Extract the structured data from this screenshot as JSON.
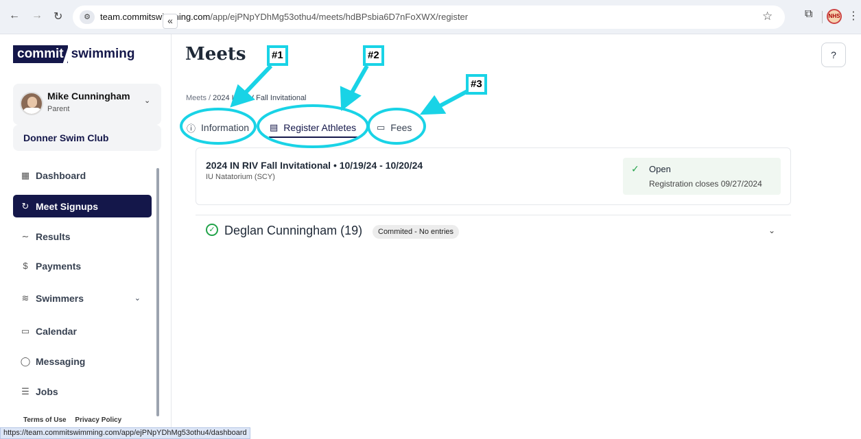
{
  "browser": {
    "url_domain": "team.commitswimming.com",
    "url_path": "/app/ejPNpYDhMg53othu4/meets/hdBPsbia6D7nFoXWX/register",
    "status_url": "https://team.commitswimming.com/app/ejPNpYDhMg53othu4/dashboard",
    "profile_text": "NHS"
  },
  "sidebar": {
    "logo_left": "commit",
    "logo_right": "swimming",
    "user_name": "Mike Cunningham",
    "user_role": "Parent",
    "club": "Donner Swim Club",
    "items": [
      {
        "label": "Dashboard",
        "icon": "grid-icon"
      },
      {
        "label": "Meet Signups",
        "icon": "swimmer-icon"
      },
      {
        "label": "Results",
        "icon": "chart-icon"
      },
      {
        "label": "Payments",
        "icon": "dollar-icon"
      },
      {
        "label": "Swimmers",
        "icon": "swim-icon"
      },
      {
        "label": "Calendar",
        "icon": "calendar-icon"
      },
      {
        "label": "Messaging",
        "icon": "chat-icon"
      },
      {
        "label": "Jobs",
        "icon": "list-icon"
      }
    ],
    "footer": {
      "terms": "Terms of Use",
      "privacy": "Privacy Policy"
    }
  },
  "main": {
    "title": "Meets",
    "breadcrumb": {
      "root": "Meets",
      "sep": "/",
      "current": "2024 IN RIV Fall Invitational"
    },
    "tabs": [
      {
        "label": "Information"
      },
      {
        "label": "Register Athletes"
      },
      {
        "label": "Fees"
      }
    ],
    "meet": {
      "title": "2024 IN RIV Fall Invitational • 10/19/24 - 10/20/24",
      "location": "IU Natatorium (SCY)",
      "status": "Open",
      "closes": "Registration closes 09/27/2024"
    },
    "athlete": {
      "name": "Deglan Cunningham (19)",
      "badge": "Commited - No entries"
    }
  },
  "annotations": [
    "#1",
    "#2",
    "#3"
  ],
  "colors": {
    "brand": "#14174a",
    "accent": "#19d3e6",
    "success": "#22a34a"
  }
}
